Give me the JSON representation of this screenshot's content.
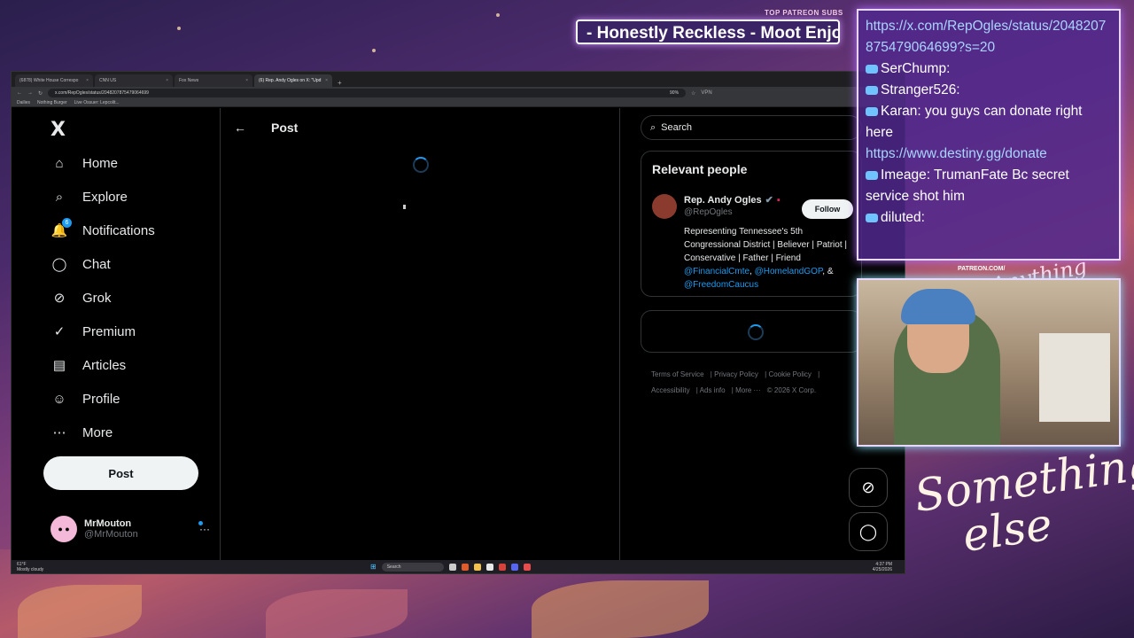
{
  "browser": {
    "tabs": [
      {
        "label": "(6878) White House Correspo",
        "active": false
      },
      {
        "label": "CNN US",
        "active": false
      },
      {
        "label": "Fox News",
        "active": false
      },
      {
        "label": "(6) Rep. Andy Ogles on X: \"Upd",
        "active": true
      }
    ],
    "url": "x.com/RepOgles/status/2048207875479064699",
    "zoom": "90%",
    "vpn": "VPN",
    "bookmarks": [
      "Dailies",
      "Nothing Burger",
      "Live Ossuer: Lepcolit..."
    ]
  },
  "x": {
    "logo": "X",
    "nav": [
      {
        "label": "Home",
        "icon": "home-icon",
        "glyph": "⌂"
      },
      {
        "label": "Explore",
        "icon": "search-icon",
        "glyph": "⌕"
      },
      {
        "label": "Notifications",
        "icon": "bell-icon",
        "glyph": "🔔",
        "badge": "6"
      },
      {
        "label": "Chat",
        "icon": "chat-icon",
        "glyph": "◯"
      },
      {
        "label": "Grok",
        "icon": "grok-icon",
        "glyph": "⊘"
      },
      {
        "label": "Premium",
        "icon": "premium-icon",
        "glyph": "✓"
      },
      {
        "label": "Articles",
        "icon": "articles-icon",
        "glyph": "▤"
      },
      {
        "label": "Profile",
        "icon": "profile-icon",
        "glyph": "☺"
      },
      {
        "label": "More",
        "icon": "more-icon",
        "glyph": "⋯"
      }
    ],
    "post_button": "Post",
    "account": {
      "name": "MrMouton",
      "handle": "@MrMouton",
      "more": "···"
    },
    "center": {
      "back": "←",
      "title": "Post"
    },
    "search_placeholder": "Search",
    "relevant": {
      "title": "Relevant people",
      "name": "Rep. Andy Ogles",
      "handle": "@RepOgles",
      "follow": "Follow",
      "bio_text": "Representing Tennessee's 5th Congressional District | Believer | Patriot | Conservative | Father | Friend",
      "bio_links": [
        "@FinancialCmte",
        "@HomelandGOP",
        "@FreedomCaucus"
      ],
      "bio_sep1": ", ",
      "bio_sep2": ", & "
    },
    "footer": {
      "links": [
        "Terms of Service",
        "Privacy Policy",
        "Cookie Policy",
        "Accessibility",
        "Ads info",
        "More ···"
      ],
      "copyright": "© 2026 X Corp."
    }
  },
  "taskbar": {
    "weather_temp": "61°F",
    "weather_desc": "Mostly cloudy",
    "search": "Search",
    "time": "4:37 PM",
    "date": "4/25/2026"
  },
  "overlay": {
    "patreon_label": "TOP PATREON SUBS",
    "ticker": "- Honestly Reckless - Moot Enjoy",
    "patreon_small": "PATREON.COM/",
    "signature_small": "Anything else?",
    "signature_large_1": "Something",
    "signature_large_2": "else"
  },
  "chat": [
    {
      "type": "link",
      "text": "https://x.com/RepOgles/status/2048207875479064699?s=20"
    },
    {
      "type": "msg",
      "user": "SerChump:",
      "text": ""
    },
    {
      "type": "msg",
      "user": "Stranger526:",
      "text": ""
    },
    {
      "type": "msg",
      "user": "Karan:",
      "text": "you guys can donate right here"
    },
    {
      "type": "link",
      "text": "https://www.destiny.gg/donate"
    },
    {
      "type": "msg",
      "user": "Imeage:",
      "text": "TrumanFate Bc secret service shot him"
    },
    {
      "type": "msg",
      "user": "diluted:",
      "text": ""
    }
  ],
  "colors": {
    "accent": "#1d9bf0",
    "chat_border": "#e6d8ff"
  }
}
